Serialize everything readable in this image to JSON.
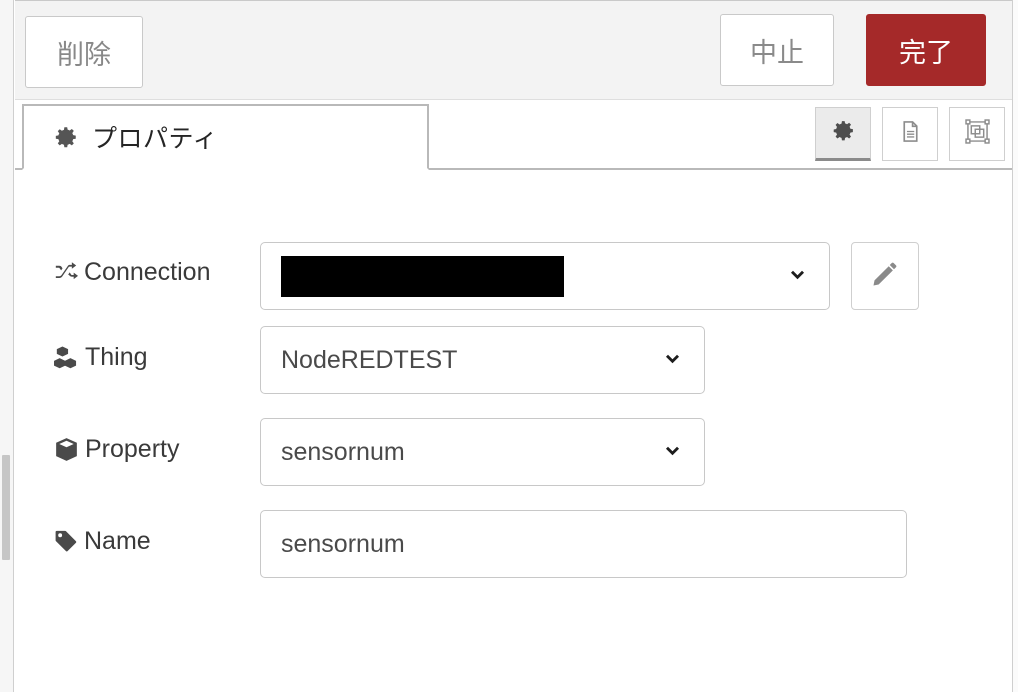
{
  "toolbar": {
    "delete_label": "削除",
    "cancel_label": "中止",
    "done_label": "完了",
    "done_color": "#a52929"
  },
  "tabs": [
    {
      "label": "プロパティ",
      "icon": "gear-icon",
      "active": true
    }
  ],
  "tab_icon_buttons": [
    {
      "name": "properties-view-button",
      "icon": "gear-icon",
      "active": true
    },
    {
      "name": "description-view-button",
      "icon": "document-icon",
      "active": false
    },
    {
      "name": "appearance-view-button",
      "icon": "appearance-icon",
      "active": false
    }
  ],
  "form": {
    "rows": [
      {
        "id": "connection",
        "label": "Connection",
        "icon": "shuffle-icon",
        "control": "select",
        "value": "",
        "redacted": true,
        "has_edit_button": true,
        "edit_icon": "pencil-icon"
      },
      {
        "id": "thing",
        "label": "Thing",
        "icon": "cubes-icon",
        "control": "select",
        "value": "NodeREDTEST",
        "redacted": false,
        "has_edit_button": false
      },
      {
        "id": "property",
        "label": "Property",
        "icon": "cube-icon",
        "control": "select",
        "value": "sensornum",
        "redacted": false,
        "has_edit_button": false
      },
      {
        "id": "name",
        "label": "Name",
        "icon": "tag-icon",
        "control": "text",
        "value": "sensornum",
        "placeholder": "Name",
        "redacted": false,
        "has_edit_button": false
      }
    ]
  }
}
